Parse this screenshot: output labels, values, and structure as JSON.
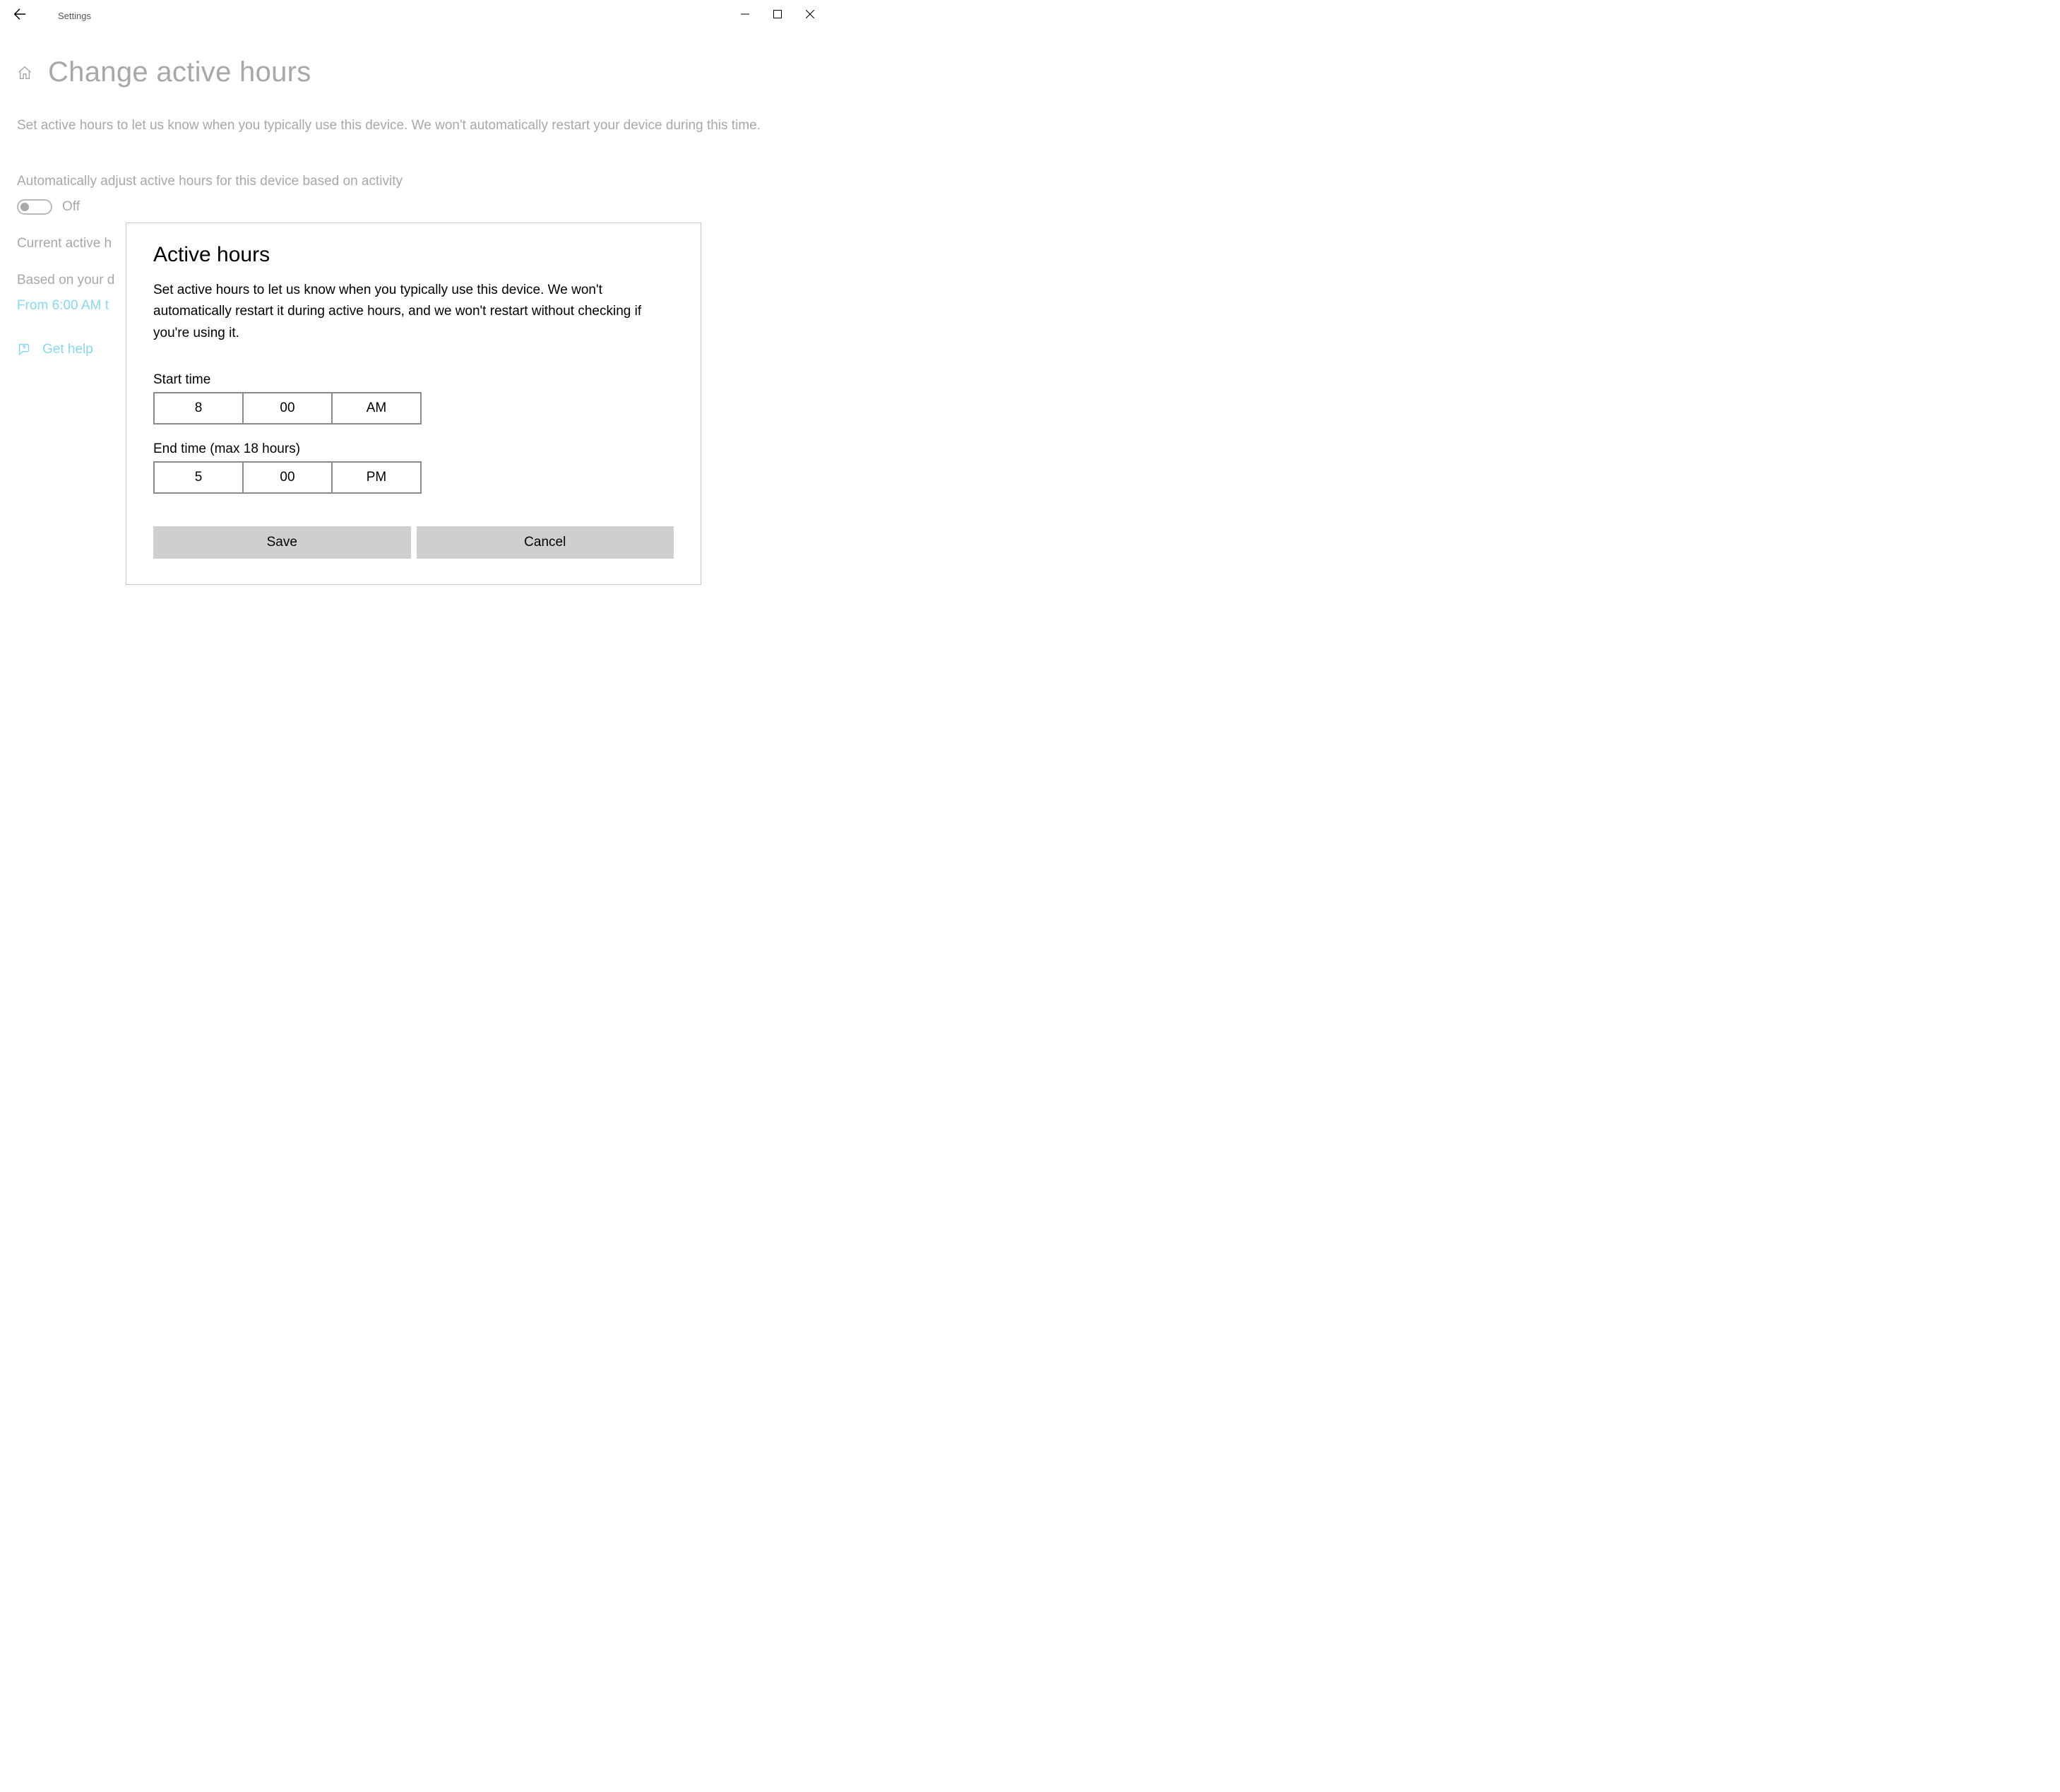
{
  "titlebar": {
    "app_title": "Settings"
  },
  "page": {
    "title": "Change active hours",
    "description": "Set active hours to let us know when you typically use this device. We won't automatically restart your device during this time.",
    "auto_adjust_label": "Automatically adjust active hours for this device based on activity",
    "toggle_state": "Off",
    "current_label": "Current active h",
    "based_on_label": "Based on your d",
    "from_link": "From 6:00 AM t",
    "help_text": "Get help"
  },
  "dialog": {
    "title": "Active hours",
    "description": "Set active hours to let us know when you typically use this device. We won't automatically restart it during active hours, and we won't restart without checking if you're using it.",
    "start_label": "Start time",
    "start_hour": "8",
    "start_minute": "00",
    "start_period": "AM",
    "end_label": "End time (max 18 hours)",
    "end_hour": "5",
    "end_minute": "00",
    "end_period": "PM",
    "save_label": "Save",
    "cancel_label": "Cancel"
  }
}
